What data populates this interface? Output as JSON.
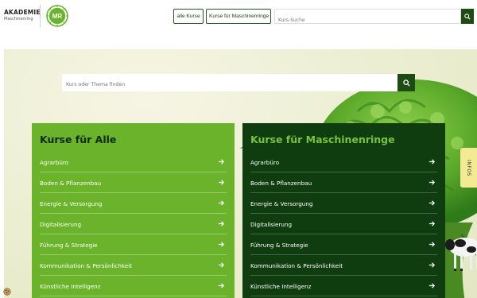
{
  "header": {
    "logo_title": "AKADEMIE",
    "logo_subtitle": "Maschinenring",
    "badge_text": "MR",
    "nav_all": "alle Kurse",
    "nav_mr": "Kurse für Maschinenringe",
    "search_placeholder": "Kurs-Suche",
    "search_icon": "search-icon"
  },
  "hero": {
    "search_placeholder": "Kurs oder Thema finden",
    "search_icon": "search-icon"
  },
  "panels": {
    "left": {
      "title": "Kurse für Alle",
      "items": [
        "Agrarbüro",
        "Boden & Pflanzenbau",
        "Energie & Versorgung",
        "Digitalisierung",
        "Führung & Strategie",
        "Kommunikation & Persönlichkeit",
        "Künstliche Intelligenz"
      ]
    },
    "right": {
      "title": "Kurse für Maschinenringe",
      "items": [
        "Agrarbüro",
        "Boden & Pflanzenbau",
        "Energie & Versorgung",
        "Digitalisierung",
        "Führung & Strategie",
        "Kommunikation & Persönlichkeit",
        "Künstliche Intelligenz"
      ]
    }
  },
  "infos_tab": "INFOS",
  "colors": {
    "brand_green": "#6ab32a",
    "dark_green": "#0f3d10",
    "button_green": "#1e4a14",
    "infos_yellow": "#f5ea94"
  }
}
